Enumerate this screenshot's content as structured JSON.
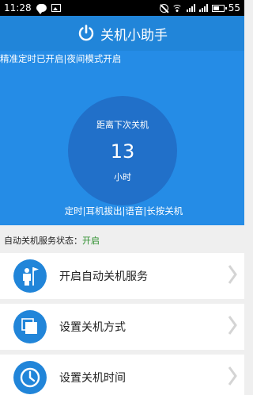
{
  "status_bar": {
    "time": "11:28",
    "left_icons": [
      "chat-bubble-icon",
      "image-icon"
    ],
    "right_icons": [
      "mute-icon",
      "wifi-icon",
      "signal-icon",
      "signal-icon",
      "battery-icon"
    ],
    "battery_percent": "55"
  },
  "app_bar": {
    "icon": "power-icon",
    "title": "关机小助手"
  },
  "hero": {
    "top_text": "精准定时已开启|夜间模式开启",
    "circle_label": "距离下次关机",
    "circle_value": "13",
    "circle_unit": "小时",
    "bottom_text": "定时|耳机拔出|语音|长按关机"
  },
  "service_status": {
    "label": "自动关机服务状态：",
    "value": "开启"
  },
  "menu": [
    {
      "label": "开启自动关机服务",
      "icon": "flag-person-icon"
    },
    {
      "label": "设置关机方式",
      "icon": "layers-icon"
    },
    {
      "label": "设置关机时间",
      "icon": "clock-icon"
    }
  ],
  "colors": {
    "app_bar": "#2185d9",
    "hero": "#258ce6",
    "circle": "#2170c9",
    "status_on": "#2a8d2a",
    "background": "#efefef"
  }
}
